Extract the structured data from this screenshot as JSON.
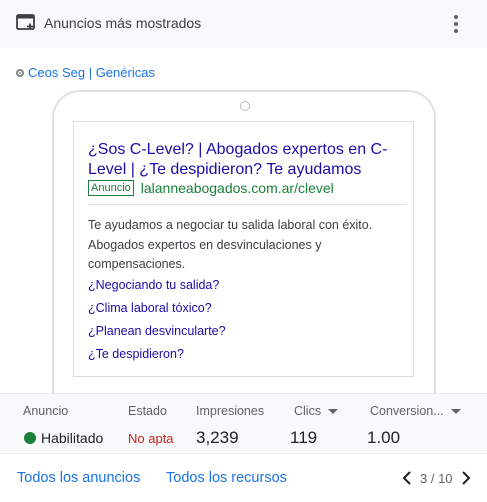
{
  "header": {
    "title": "Anuncios más mostrados",
    "icon": "window-add-icon",
    "menu_icon": "more-vert-icon"
  },
  "campaign": {
    "name": "Ceos Seg | Genéricas",
    "color": "#1a73e8"
  },
  "ad": {
    "headline_1": "¿Sos C-Level? | Abogados expertos en C-",
    "headline_2": "Level | ¿Te despidieron? Te ayudamos",
    "badge": "Anuncio",
    "url": "lalanneabogados.com.ar/clevel",
    "description_1": "Te ayudamos a negociar tu salida laboral con éxito.",
    "description_2": "Abogados expertos en desvinculaciones y",
    "description_3": "compensaciones.",
    "sitelinks": [
      "¿Negociando tu salida?",
      "¿Clima laboral tóxico?",
      "¿Planean desvincularte?",
      "¿Te despidieron?"
    ]
  },
  "stats": {
    "col_ad_label": "Anuncio",
    "col_status_label": "Estado",
    "col_impressions_label": "Impresiones",
    "col_clicks_label": "Clics",
    "col_conversions_label": "Conversion...",
    "ad_status": "Habilitado",
    "eligibility": "No apta",
    "impressions": "3,239",
    "clicks": "119",
    "conversions": "1.00",
    "status_color": "#188038",
    "eligibility_color": "#c5221f"
  },
  "footer": {
    "all_ads": "Todos los anuncios",
    "all_assets": "Todos los recursos",
    "page": "3 / 10"
  }
}
